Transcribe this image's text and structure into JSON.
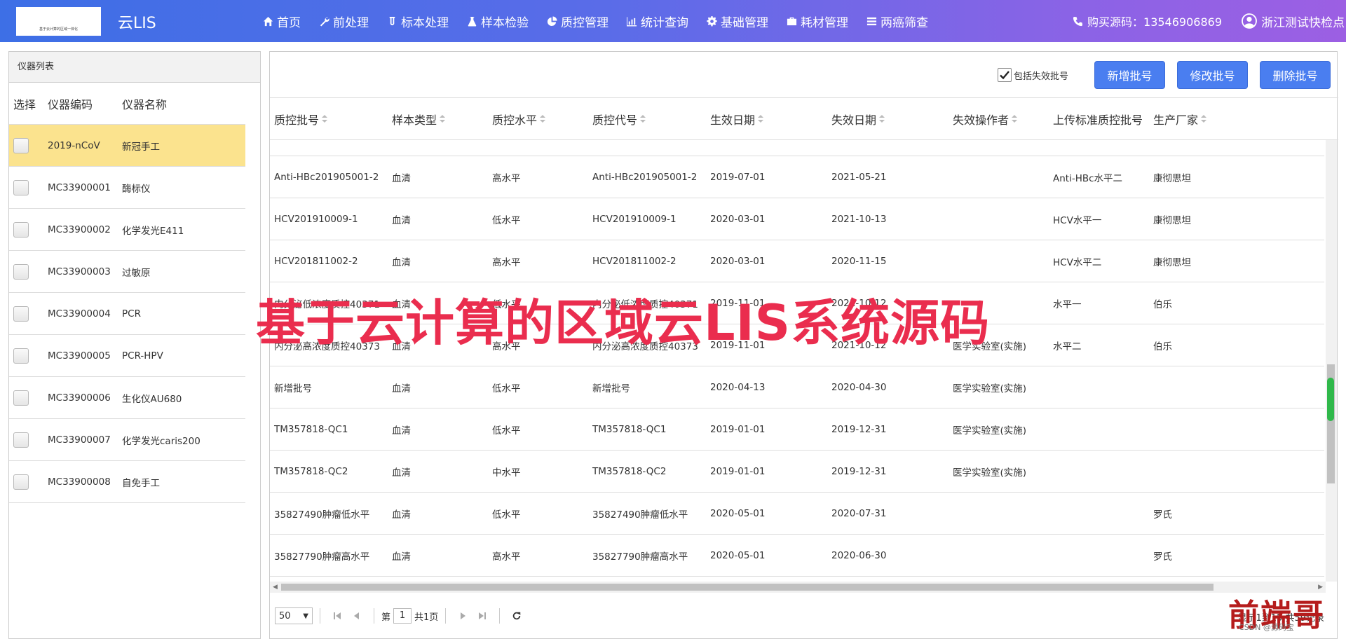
{
  "app": {
    "logo_text": "基于云计算的区域一体化",
    "title": "云LIS"
  },
  "nav": [
    {
      "label": "首页",
      "icon": "home-icon"
    },
    {
      "label": "前处理",
      "icon": "wrench-icon"
    },
    {
      "label": "标本处理",
      "icon": "tube-icon"
    },
    {
      "label": "样本检验",
      "icon": "flask-icon"
    },
    {
      "label": "质控管理",
      "icon": "pie-chart-icon"
    },
    {
      "label": "统计查询",
      "icon": "bar-chart-icon"
    },
    {
      "label": "基础管理",
      "icon": "gear-icon"
    },
    {
      "label": "耗材管理",
      "icon": "briefcase-icon"
    },
    {
      "label": "两癌筛查",
      "icon": "list-icon"
    }
  ],
  "header_right": {
    "phone_label": "购买源码：13546906869",
    "user_name": "浙江测试快检点"
  },
  "left_panel": {
    "title": "仪器列表",
    "columns": {
      "select": "选择",
      "code": "仪器编码",
      "name": "仪器名称"
    },
    "rows": [
      {
        "code": "2019-nCoV",
        "name": "新冠手工",
        "selected": true
      },
      {
        "code": "MC33900001",
        "name": "酶标仪"
      },
      {
        "code": "MC33900002",
        "name": "化学发光E411"
      },
      {
        "code": "MC33900003",
        "name": "过敏原"
      },
      {
        "code": "MC33900004",
        "name": "PCR"
      },
      {
        "code": "MC33900005",
        "name": "PCR-HPV"
      },
      {
        "code": "MC33900006",
        "name": "生化仪AU680"
      },
      {
        "code": "MC33900007",
        "name": "化学发光caris200"
      },
      {
        "code": "MC33900008",
        "name": "自免手工"
      }
    ]
  },
  "toolbar": {
    "include_invalid_label": "包括失效批号",
    "include_invalid_checked": true,
    "add_label": "新增批号",
    "edit_label": "修改批号",
    "delete_label": "删除批号"
  },
  "table": {
    "columns": [
      "质控批号",
      "样本类型",
      "质控水平",
      "质控代号",
      "生效日期",
      "失效日期",
      "失效操作者",
      "上传标准质控批号",
      "生产厂家"
    ],
    "rows": [
      [
        "Anti-HBc201905001-2",
        "血清",
        "高水平",
        "Anti-HBc201905001-2",
        "2019-07-01",
        "2021-05-21",
        "",
        "Anti-HBc水平二",
        "康彻思坦"
      ],
      [
        "HCV201910009-1",
        "血清",
        "低水平",
        "HCV201910009-1",
        "2020-03-01",
        "2021-10-13",
        "",
        "HCV水平一",
        "康彻思坦"
      ],
      [
        "HCV201811002-2",
        "血清",
        "高水平",
        "HCV201811002-2",
        "2020-03-01",
        "2020-11-15",
        "",
        "HCV水平二",
        "康彻思坦"
      ],
      [
        "内分泌低浓度质控40371",
        "血清",
        "低水平",
        "内分泌低浓度质控40371",
        "2019-11-01",
        "2021-10-12",
        "",
        "水平一",
        "伯乐"
      ],
      [
        "内分泌高浓度质控40373",
        "血清",
        "高水平",
        "内分泌高浓度质控40373",
        "2019-11-01",
        "2021-10-12",
        "医学实验室(实施)",
        "水平二",
        "伯乐"
      ],
      [
        "新增批号",
        "血清",
        "低水平",
        "新增批号",
        "2020-04-13",
        "2020-04-30",
        "医学实验室(实施)",
        "",
        ""
      ],
      [
        "TM357818-QC1",
        "血清",
        "低水平",
        "TM357818-QC1",
        "2019-01-01",
        "2019-12-31",
        "医学实验室(实施)",
        "",
        ""
      ],
      [
        "TM357818-QC2",
        "血清",
        "中水平",
        "TM357818-QC2",
        "2019-01-01",
        "2019-12-31",
        "医学实验室(实施)",
        "",
        ""
      ],
      [
        "35827490肿瘤低水平",
        "血清",
        "低水平",
        "35827490肿瘤低水平",
        "2020-05-01",
        "2020-07-31",
        "",
        "",
        "罗氏"
      ],
      [
        "35827790肿瘤高水平",
        "血清",
        "高水平",
        "35827790肿瘤高水平",
        "2020-05-01",
        "2020-06-30",
        "",
        "",
        "罗氏"
      ]
    ]
  },
  "pager": {
    "page_size": "50",
    "page_prefix": "第",
    "page_number": "1",
    "page_total": "共1页",
    "info": "显示1到15,共59记录"
  },
  "overlay": {
    "banner": "基于云计算的区域云LIS系统源码",
    "corner_logo": "前端哥",
    "corner_credit": "CSDN @源码宝"
  },
  "colors": {
    "nav_gradient_start": "#3d6fe6",
    "nav_gradient_end": "#9c5fe3",
    "button": "#4a7ef0",
    "selected_row": "#fbe38e",
    "banner": "#ea2d4e"
  }
}
